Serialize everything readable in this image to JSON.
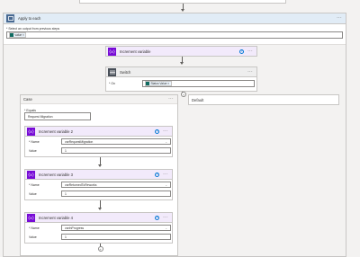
{
  "apply_each": {
    "title": "Apply to each",
    "output_label": "* Select an output from previous steps",
    "output_token": "value"
  },
  "increment_top": {
    "title": "Increment variable"
  },
  "switch": {
    "title": "Switch",
    "on_label": "* On",
    "on_token": "Status Value"
  },
  "case": {
    "title": "Case",
    "equals_label": "* Equals",
    "equals_value": "Request Migration"
  },
  "default": {
    "title": "Default"
  },
  "increments": [
    {
      "title": "Increment variable 2",
      "name_label": "* Name",
      "name_value": "varRequestMigration",
      "value_label": "Value",
      "value": "1"
    },
    {
      "title": "Increment variable 3",
      "name_label": "* Name",
      "name_value": "varReturnedToReworks",
      "value_label": "Value",
      "value": "1"
    },
    {
      "title": "Increment variable 4",
      "name_label": "* Name",
      "name_value": "varInProgress",
      "value_label": "Value",
      "value": "1"
    }
  ],
  "icons": {
    "loop": "loop-icon",
    "variable": "variable-icon",
    "switch": "switch-icon",
    "help": "help-icon",
    "more": "more-options-icon",
    "add": "add-icon"
  },
  "colors": {
    "variable_accent": "#770bd6",
    "variable_header": "#f2eafb",
    "token": "#0f6b61",
    "link": "#0078d4"
  }
}
